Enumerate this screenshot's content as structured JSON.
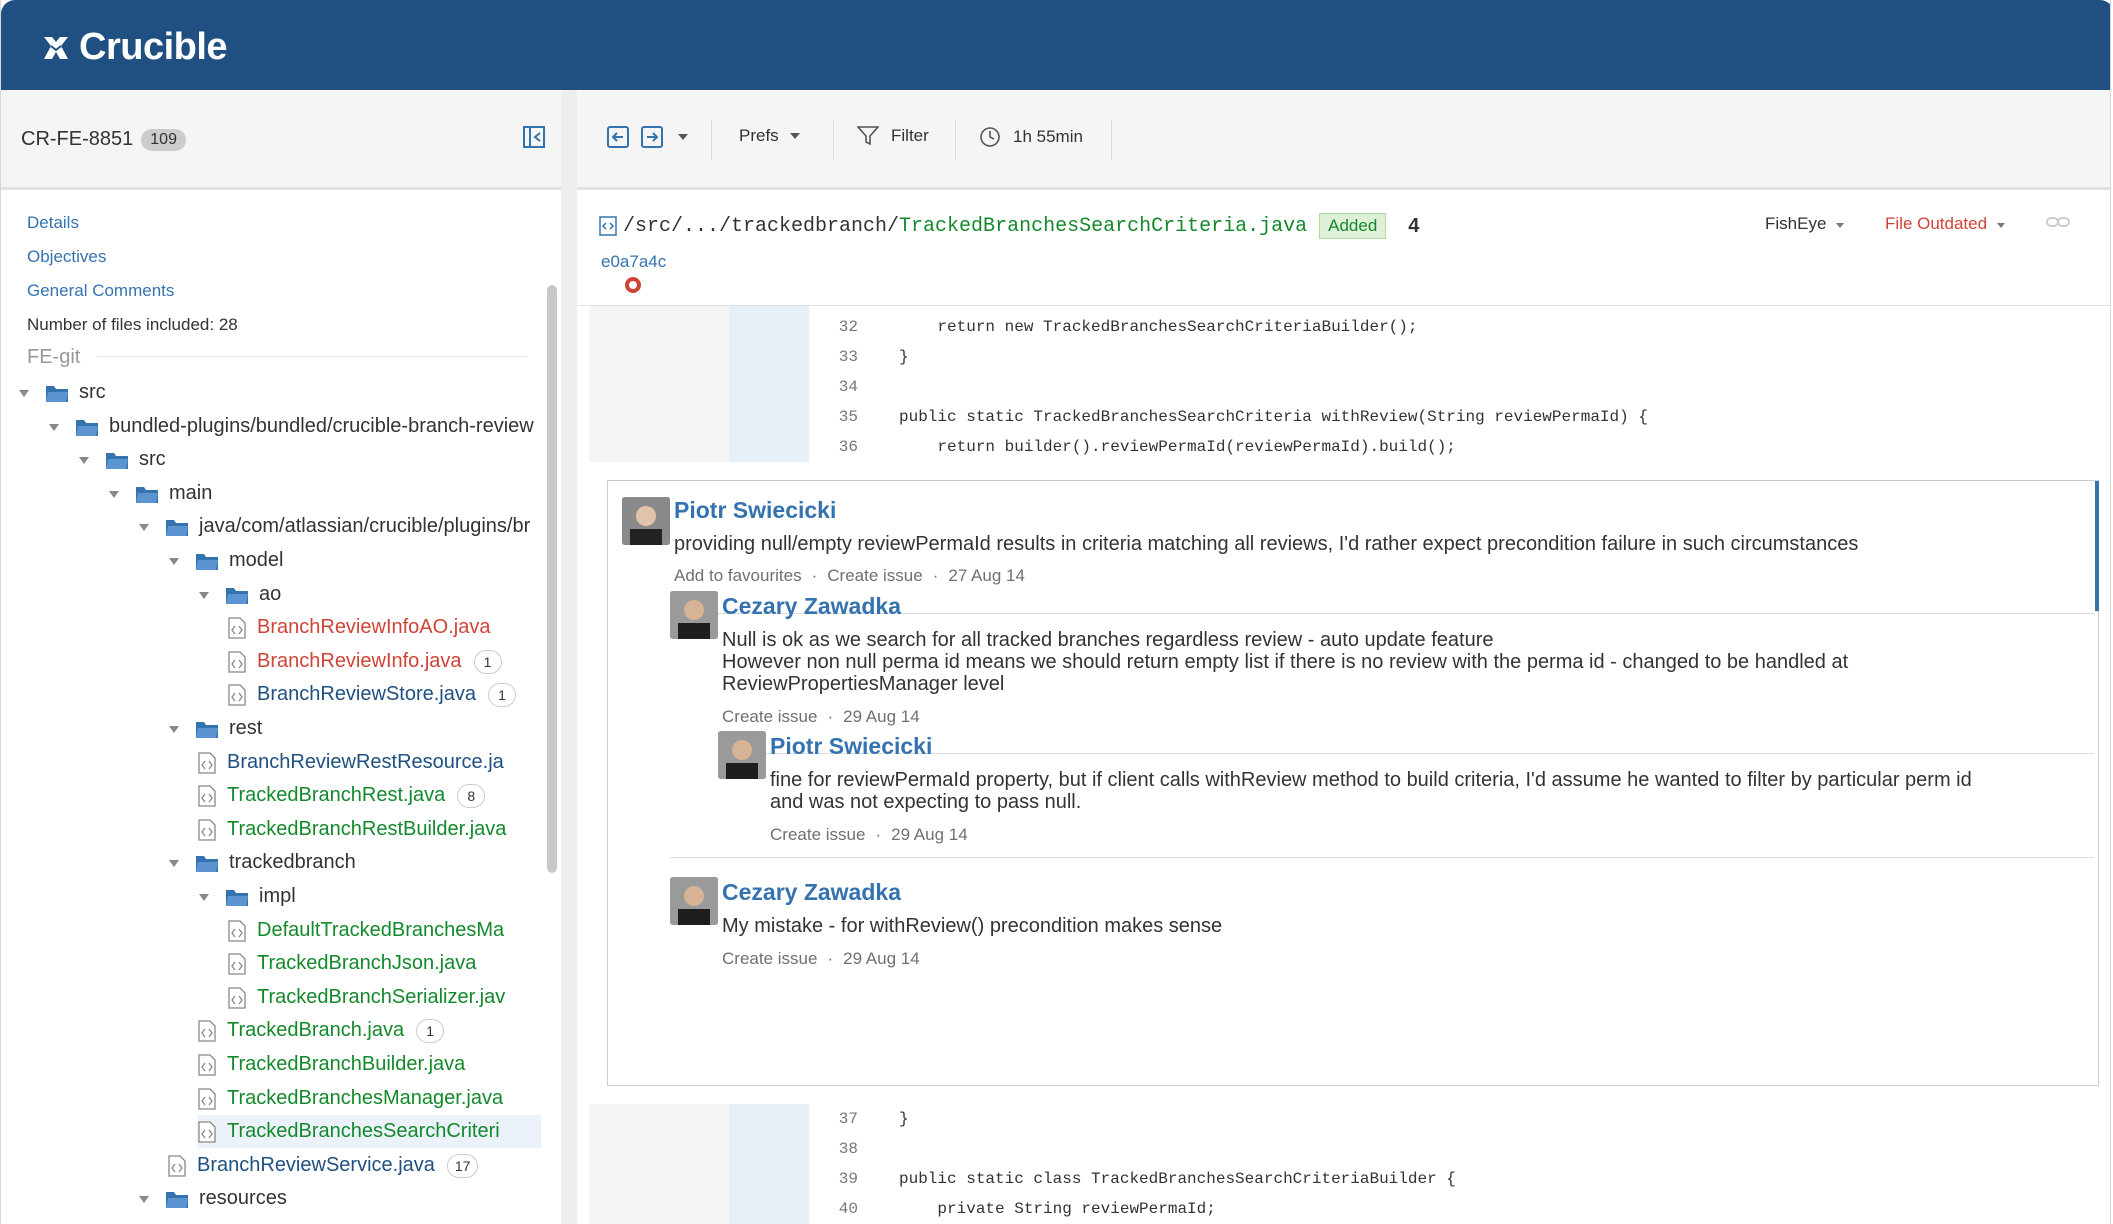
{
  "app": {
    "name": "Crucible"
  },
  "sidebar": {
    "review_key": "CR-FE-8851",
    "review_count": "109",
    "links": [
      "Details",
      "Objectives",
      "General Comments"
    ],
    "files_included": "Number of files included: 28",
    "repo": "FE-git",
    "tree": [
      {
        "name": "src",
        "type": "folder",
        "kind": "dark",
        "badge": ""
      },
      {
        "name": "bundled-plugins/bundled/crucible-branch-review",
        "type": "folder",
        "kind": "dark",
        "badge": ""
      },
      {
        "name": "src",
        "type": "folder",
        "kind": "dark",
        "badge": ""
      },
      {
        "name": "main",
        "type": "folder",
        "kind": "dark",
        "badge": ""
      },
      {
        "name": "java/com/atlassian/crucible/plugins/br",
        "type": "folder",
        "kind": "dark",
        "badge": ""
      },
      {
        "name": "model",
        "type": "folder",
        "kind": "dark",
        "badge": ""
      },
      {
        "name": "ao",
        "type": "folder",
        "kind": "dark",
        "badge": ""
      },
      {
        "name": "BranchReviewInfoAO.java",
        "type": "file",
        "kind": "red",
        "badge": ""
      },
      {
        "name": "BranchReviewInfo.java",
        "type": "file",
        "kind": "red",
        "badge": "1"
      },
      {
        "name": "BranchReviewStore.java",
        "type": "file",
        "kind": "blue",
        "badge": "1"
      },
      {
        "name": "rest",
        "type": "folder",
        "kind": "dark",
        "badge": ""
      },
      {
        "name": "BranchReviewRestResource.ja",
        "type": "file",
        "kind": "blue",
        "badge": ""
      },
      {
        "name": "TrackedBranchRest.java",
        "type": "file",
        "kind": "green",
        "badge": "8"
      },
      {
        "name": "TrackedBranchRestBuilder.java",
        "type": "file",
        "kind": "green",
        "badge": ""
      },
      {
        "name": "trackedbranch",
        "type": "folder",
        "kind": "dark",
        "badge": ""
      },
      {
        "name": "impl",
        "type": "folder",
        "kind": "dark",
        "badge": ""
      },
      {
        "name": "DefaultTrackedBranchesMa",
        "type": "file",
        "kind": "green",
        "badge": ""
      },
      {
        "name": "TrackedBranchJson.java",
        "type": "file",
        "kind": "green",
        "badge": ""
      },
      {
        "name": "TrackedBranchSerializer.jav",
        "type": "file",
        "kind": "green",
        "badge": ""
      },
      {
        "name": "TrackedBranch.java",
        "type": "file",
        "kind": "green",
        "badge": "1"
      },
      {
        "name": "TrackedBranchBuilder.java",
        "type": "file",
        "kind": "green",
        "badge": ""
      },
      {
        "name": "TrackedBranchesManager.java",
        "type": "file",
        "kind": "green",
        "badge": ""
      },
      {
        "name": "TrackedBranchesSearchCriteri",
        "type": "file",
        "kind": "green",
        "badge": ""
      },
      {
        "name": "BranchReviewService.java",
        "type": "file",
        "kind": "blue",
        "badge": "17"
      },
      {
        "name": "resources",
        "type": "folder",
        "kind": "dark",
        "badge": ""
      }
    ]
  },
  "toolbar": {
    "prefs": "Prefs",
    "filter": "Filter",
    "time": "1h 55min"
  },
  "file": {
    "path_prefix": "/src/.../trackedbranch/",
    "file_name": "TrackedBranchesSearchCriteria.java",
    "status": "Added",
    "comment_count": "4",
    "revision": "e0a7a4c",
    "fisheye": "FishEye",
    "outdated": "File Outdated"
  },
  "code_top": [
    {
      "n": "32",
      "t": "    return new TrackedBranchesSearchCriteriaBuilder();"
    },
    {
      "n": "33",
      "t": "}"
    },
    {
      "n": "34",
      "t": ""
    },
    {
      "n": "35",
      "t": "public static TrackedBranchesSearchCriteria withReview(String reviewPermaId) {"
    },
    {
      "n": "36",
      "t": "    return builder().reviewPermaId(reviewPermaId).build();"
    }
  ],
  "code_bottom": [
    {
      "n": "37",
      "t": "}"
    },
    {
      "n": "38",
      "t": ""
    },
    {
      "n": "39",
      "t": "public static class TrackedBranchesSearchCriteriaBuilder {"
    },
    {
      "n": "40",
      "t": "    private String reviewPermaId;"
    }
  ],
  "comments": [
    {
      "author": "Piotr Swiecicki",
      "text": "providing null/empty reviewPermaId results in criteria matching all reviews, I'd rather expect precondition failure in such circumstances",
      "actions": [
        "Add to favourites",
        "Create issue"
      ],
      "date": "27 Aug 14"
    },
    {
      "author": "Cezary Zawadka",
      "text": "Null is ok as we search for all tracked branches regardless review - auto update feature",
      "text2": "However non null perma id means we should return empty list if there is no review with the perma id - changed to be handled at",
      "text3": "ReviewPropertiesManager level",
      "actions": [
        "Create issue"
      ],
      "date": "29 Aug 14"
    },
    {
      "author": "Piotr Swiecicki",
      "text": "fine for reviewPermaId property, but if client calls withReview method to build criteria, I'd assume he wanted to filter by particular perm id",
      "text2": "and was not expecting to pass null.",
      "actions": [
        "Create issue"
      ],
      "date": "29 Aug 14"
    },
    {
      "author": "Cezary Zawadka",
      "text": "My mistake - for withReview() precondition makes sense",
      "actions": [
        "Create issue"
      ],
      "date": "29 Aug 14"
    }
  ]
}
